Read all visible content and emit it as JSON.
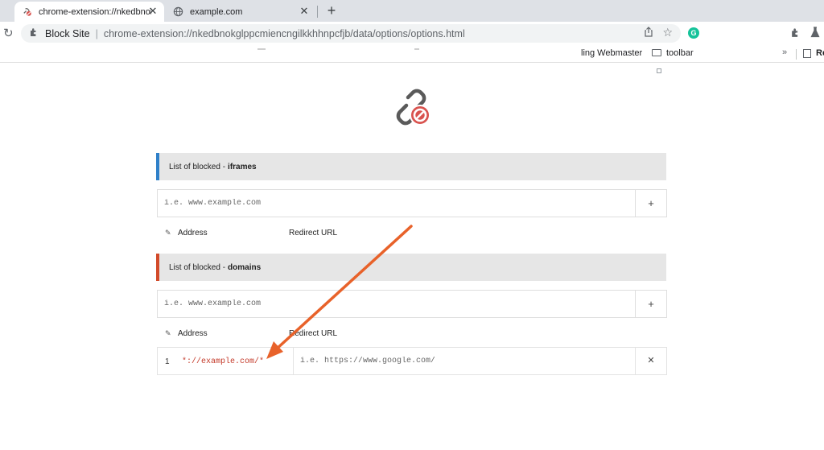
{
  "browser": {
    "tabs": [
      {
        "title": "chrome-extension://nkedbnokglppcmiencngilkkhhnpcfjb",
        "close": "✕",
        "icon": "blocked-link-icon"
      },
      {
        "title": "example.com",
        "close": "✕",
        "icon": "globe-icon"
      }
    ],
    "new_tab": "+",
    "reload": "↻",
    "omnibox": {
      "site_name": "Block Site",
      "separator": "|",
      "url": "chrome-extension://nkedbnokglppcmiencngilkkhhnpcfjb/data/options/options.html"
    },
    "grammarly_letter": "G",
    "bookmarks": {
      "item1": "ling Webmaster",
      "item2": "toolbar",
      "more": "»",
      "reading": "Re"
    }
  },
  "page": {
    "logo_icon": "blocked-link-icon",
    "sections": [
      {
        "header_prefix": "List of blocked -",
        "header_bold": "iframes",
        "accent": "#2f80c9",
        "input_placeholder": "i.e. www.example.com",
        "add_label": "+",
        "col_address": "Address",
        "col_redirect": "Redirect URL",
        "rows": []
      },
      {
        "header_prefix": "List of blocked -",
        "header_bold": "domains",
        "accent": "#d24a2a",
        "input_placeholder": "i.e. www.example.com",
        "add_label": "+",
        "col_address": "Address",
        "col_redirect": "Redirect URL",
        "rows": [
          {
            "index": "1",
            "domain": "*://example.com/*",
            "redirect_placeholder": "i.e. https://www.google.com/",
            "remove": "✕"
          }
        ]
      }
    ]
  },
  "annotation": {
    "arrow_color": "#e8622a"
  }
}
